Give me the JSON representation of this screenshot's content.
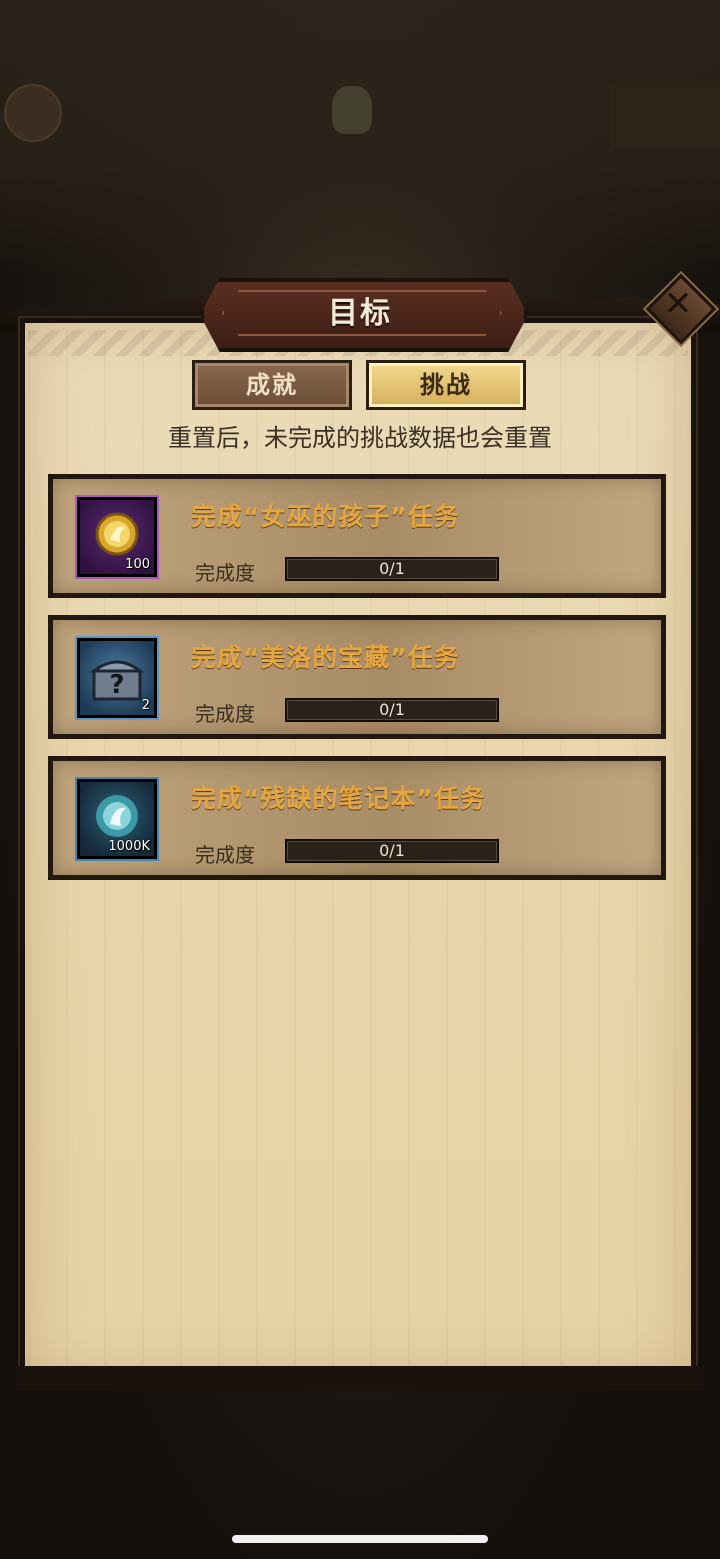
{
  "header": {
    "title": "目标",
    "close_icon": "close-icon"
  },
  "tabs": [
    {
      "label": "成就",
      "selected": false
    },
    {
      "label": "挑战",
      "selected": true
    }
  ],
  "notice": "重置后，未完成的挑战数据也会重置",
  "tasks": [
    {
      "title": "完成“女巫的孩子”任务",
      "progress_label": "完成度",
      "progress_text": "0/1",
      "progress_fraction": 0,
      "reward_icon": "gold-orb-icon",
      "reward_count": "100"
    },
    {
      "title": "完成“美洛的宝藏”任务",
      "progress_label": "完成度",
      "progress_text": "0/1",
      "progress_fraction": 0,
      "reward_icon": "mystery-chest-icon",
      "reward_count": "2"
    },
    {
      "title": "完成“残缺的笔记本”任务",
      "progress_label": "完成度",
      "progress_text": "0/1",
      "progress_fraction": 0,
      "reward_icon": "spirit-orb-icon",
      "reward_count": "1000K"
    }
  ],
  "colors": {
    "title_gold": "#e6a640",
    "parchment": "#e8d6ae",
    "tab_active": "#f3d98f"
  }
}
